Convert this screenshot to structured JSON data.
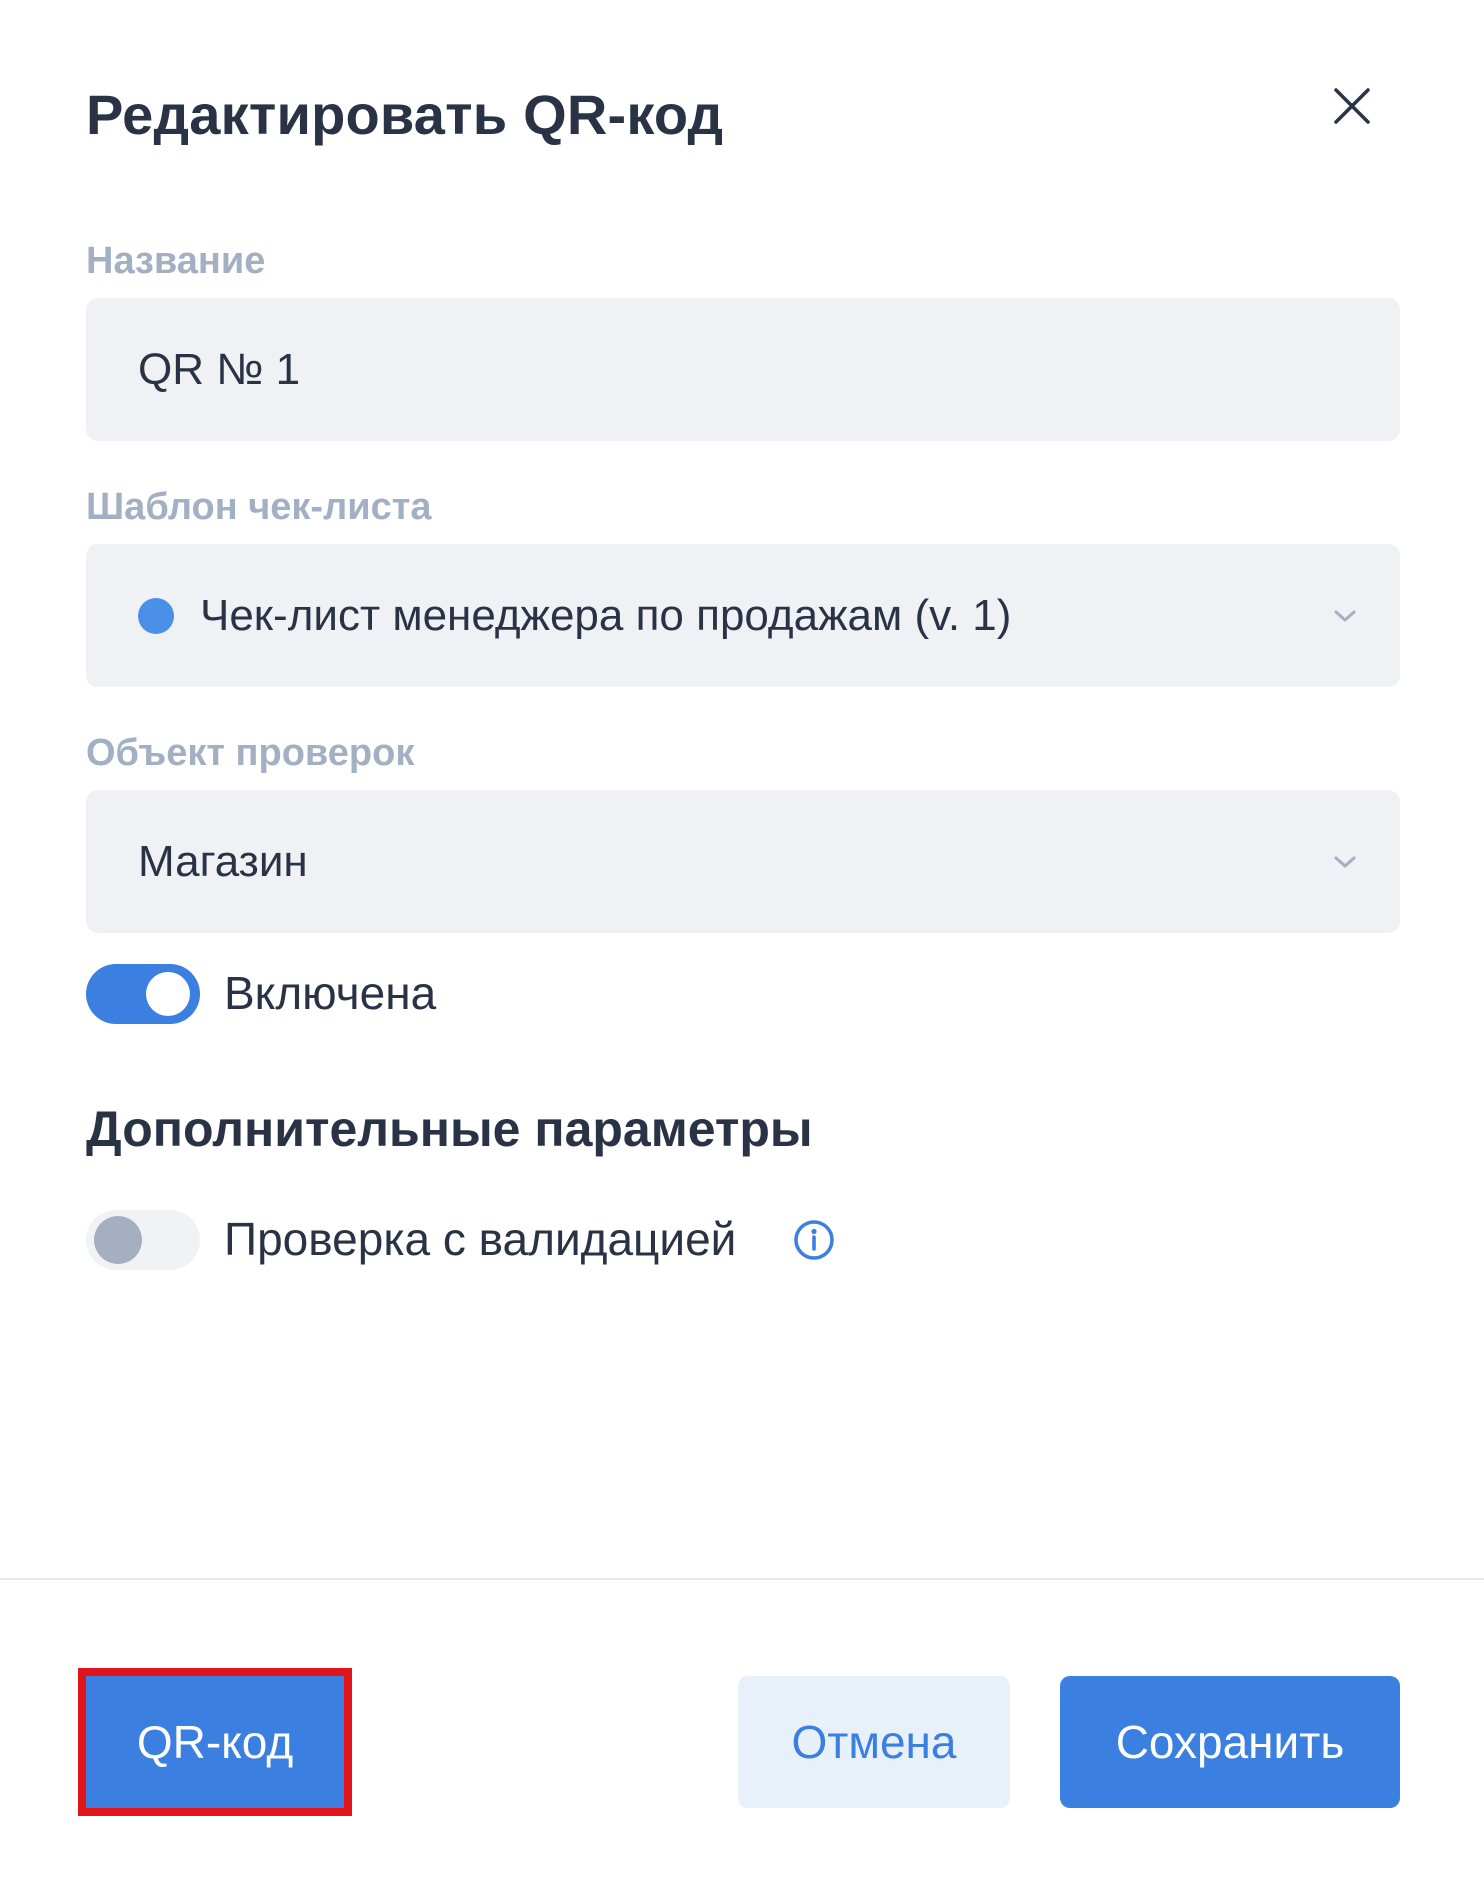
{
  "dialog": {
    "title": "Редактировать QR-код",
    "close_icon": "close-icon"
  },
  "fields": {
    "name": {
      "label": "Название",
      "value": "QR № 1"
    },
    "template": {
      "label": "Шаблон чек-листа",
      "value": "Чек-лист менеджера по продажам (v. 1)",
      "dot_color": "#4a8fe8",
      "icon": "chevron-down-icon"
    },
    "object": {
      "label": "Объект проверок",
      "value": "Магазин",
      "icon": "chevron-down-icon"
    }
  },
  "enabled_toggle": {
    "label": "Включена",
    "on": true
  },
  "additional": {
    "title": "Дополнительные параметры",
    "validation_toggle": {
      "label": "Проверка с валидацией",
      "on": false,
      "info_icon": "info-icon"
    }
  },
  "footer": {
    "qr_label": "QR-код",
    "cancel_label": "Отмена",
    "save_label": "Сохранить"
  },
  "colors": {
    "accent": "#3b7fe1",
    "highlight": "#e0141a",
    "text": "#2a3346",
    "label": "#a3b0c4"
  }
}
